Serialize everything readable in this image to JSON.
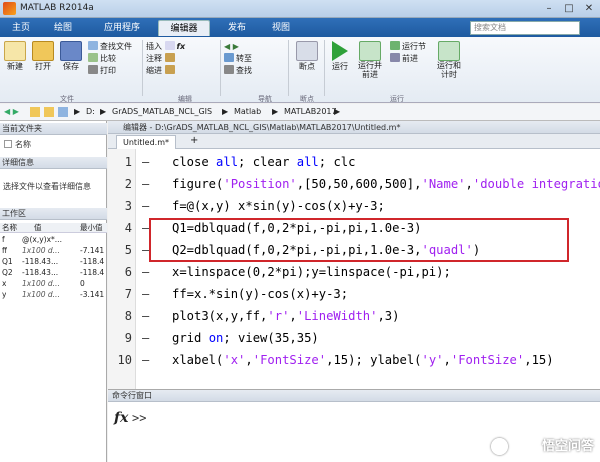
{
  "window": {
    "title": "MATLAB R2014a"
  },
  "tabs": [
    "主页",
    "绘图",
    "应用程序",
    "编辑器",
    "发布",
    "视图"
  ],
  "active_tab_index": 3,
  "search": {
    "placeholder": "搜索文档"
  },
  "ribbon": {
    "new": "新建",
    "open": "打开",
    "save": "保存",
    "find_files": "查找文件",
    "compare": "比较",
    "print": "打印",
    "insert": "插入",
    "comment": "注释",
    "indent": "缩进",
    "goto": "转至",
    "find": "查找",
    "breakpoints": "断点",
    "run": "运行",
    "run_advance": "运行并前进",
    "advance": "前进",
    "run_section": "运行节",
    "run_time": "运行和计时",
    "groups": {
      "file": "文件",
      "edit": "编辑",
      "navigate": "导航",
      "breakpoint": "断点",
      "run": "运行"
    }
  },
  "path": {
    "drive": "D:",
    "parts": [
      "GrADS_MATLAB_NCL_GIS",
      "Matlab",
      "MATLAB2017"
    ]
  },
  "current_folder": {
    "title": "当前文件夹",
    "col_name": "名称"
  },
  "details": {
    "title": "详细信息",
    "text": "选择文件以查看详细信息"
  },
  "workspace": {
    "title": "工作区",
    "cols": [
      "名称",
      "值",
      "最小值"
    ],
    "rows": [
      {
        "name": "f",
        "value": "@(x,y)x*...",
        "min": ""
      },
      {
        "name": "ff",
        "value": "1x100 d...",
        "min": "-7.141"
      },
      {
        "name": "Q1",
        "value": "-118.43...",
        "min": "-118.4"
      },
      {
        "name": "Q2",
        "value": "-118.43...",
        "min": "-118.4"
      },
      {
        "name": "x",
        "value": "1x100 d...",
        "min": "0"
      },
      {
        "name": "y",
        "value": "1x100 d...",
        "min": "-3.141"
      }
    ]
  },
  "editor": {
    "header": "编辑器 - D:\\GrADS_MATLAB_NCL_GIS\\Matlab\\MATLAB2017\\Untitled.m*",
    "tab": "Untitled.m*",
    "add_tab": "+",
    "lines": [
      "1",
      "2",
      "3",
      "4",
      "5",
      "6",
      "7",
      "8",
      "9",
      "10"
    ],
    "code": {
      "l1_a": "close ",
      "l1_k1": "all",
      "l1_b": "; clear ",
      "l1_k2": "all",
      "l1_c": "; clc",
      "l2_a": "figure(",
      "l2_s1": "'Position'",
      "l2_b": ",[50,50,600,500],",
      "l2_s2": "'Name'",
      "l2_c": ",",
      "l2_s3": "'double integration'",
      "l3": "f=@(x,y) x*sin(y)-cos(x)+y-3;",
      "l4": "Q1=dblquad(f,0,2*pi,-pi,pi,1.0e-3)",
      "l5_a": "Q2=dblquad(f,0,2*pi,-pi,pi,1.0e-3,",
      "l5_s": "'quadl'",
      "l5_b": ")",
      "l6": "x=linspace(0,2*pi);y=linspace(-pi,pi);",
      "l7": "ff=x.*sin(y)-cos(x)+y-3;",
      "l8_a": "plot3(x,y,ff,",
      "l8_s1": "'r'",
      "l8_b": ",",
      "l8_s2": "'LineWidth'",
      "l8_c": ",3)",
      "l9_a": "grid ",
      "l9_k": "on",
      "l9_b": "; view(35,35)",
      "l10_a": "xlabel(",
      "l10_s1": "'x'",
      "l10_b": ",",
      "l10_s2": "'FontSize'",
      "l10_c": ",15); ylabel(",
      "l10_s3": "'y'",
      "l10_d": ",",
      "l10_s4": "'FontSize'",
      "l10_e": ",15)"
    }
  },
  "command_window": {
    "title": "命令行窗口",
    "fx": "fx",
    "prompt": ">>"
  },
  "watermark": "悟空问答",
  "colors": {
    "highlight_box": "#d0262b",
    "keyword": "#0000ff",
    "string": "#a020f0"
  }
}
